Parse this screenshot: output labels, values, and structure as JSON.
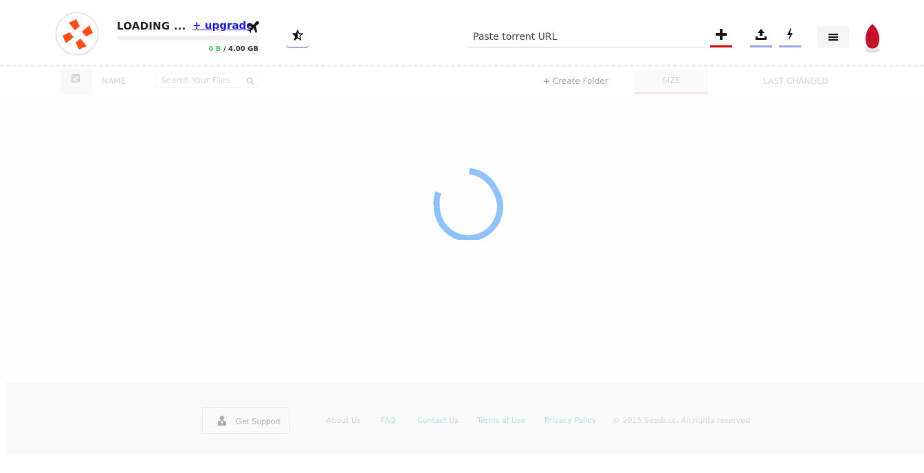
{
  "header": {
    "user_name": "LOADING ...",
    "upgrade_label": "+ upgrade",
    "storage_used": "0 B",
    "storage_separator": " / ",
    "storage_total": "4.00 GB",
    "storage_fraction": 0,
    "url_placeholder": "Paste torrent URL",
    "icons": {
      "logo": "seedr-logo",
      "upgrade": "airplane-icon",
      "favorites": "star-icon",
      "add": "plus-icon",
      "upload": "upload-icon",
      "flash": "lightning-icon",
      "menu": "hamburger-menu-icon",
      "avatar": "seed-avatar"
    }
  },
  "table": {
    "name_label": "NAME",
    "search_placeholder": "Search Your Files",
    "create_folder_plus": "+",
    "create_folder_label": "Create Folder",
    "size_label": "SIZE",
    "last_changed_label": "LAST CHANGED"
  },
  "loading": {
    "state": "loading",
    "spinner_color": "#8fc1fb"
  },
  "footer": {
    "support_label": "Get Support",
    "links": [
      "About Us",
      "FAQ",
      "Contact Us",
      "Terms of Use",
      "Privacy Policy"
    ],
    "copyright": "© 2015 Seedr.cc, All rights reserved"
  },
  "colors": {
    "brand_orange": "#ff4d1a",
    "add_accent": "#d40000",
    "button_accent": "#9aa8e8",
    "storage_green": "#3fcf5a",
    "link_blue": "#1a1ad6",
    "avatar_red": "#c8102e"
  }
}
